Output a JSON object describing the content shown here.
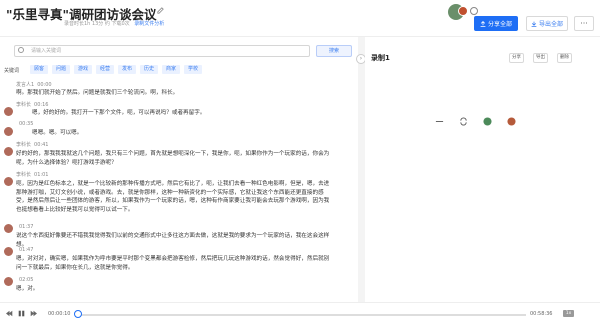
{
  "header": {
    "title": "\"乐里寻真\"调研团访谈会议",
    "meta": "录音时长1h 13分 约 下载0次",
    "meta_link": "录制文件分析"
  },
  "actions": {
    "share_label": "分享全部",
    "export_label": "导出全部",
    "more_label": "···"
  },
  "search": {
    "placeholder": "请输入关键词",
    "button_label": "搜索"
  },
  "keywords": {
    "label": "关键词",
    "items": [
      "顾客",
      "问题",
      "游戏",
      "经营",
      "发布",
      "历史",
      "商家",
      "学校"
    ]
  },
  "transcript": [
    {
      "speaker": "发言人1",
      "time": "00:00",
      "text": "啊。那我们就开始了然后。问题是就我们三个轮流问。啊，科长。"
    },
    {
      "speaker": "李科长",
      "time": "00:16",
      "text": "嗯，好的好的。我打开一下那个文件，呃，可以再说吗？或者再留字。"
    },
    {
      "speaker": "",
      "time": "00:35",
      "text": "嗯嗯。嗯。可以嗯。"
    },
    {
      "speaker": "李科长",
      "time": "00:41",
      "text": "好的好的，那我我我就这几个问题，我只有三个问题，首先就是想呃深化一下，我是你，呃，如果你作为一个玩家的话，你会为呢，为什么选择体验？呃打游戏手游呢？"
    },
    {
      "speaker": "李科长",
      "time": "01:01",
      "text": "呃，因为是红色标本之，就是一个比较新的那种传播方式吧，然后它有比了，呃，让我们去看一种红色电影啊，但是，嗯，去进那种游打咖，艾灯文创小说，或者游戏。去，就是你那样，这种一种新资化的一个实际感，它就让我这个东西能还更直接的感受，是然后然后让一些团体的游客，所以，如果我作为一个玩家的话，嗯，这种有作商家要让我可能会去玩那个游戏啊，因为我也挺想看看上比较好是我可以觉得可以试一下。"
    },
    {
      "speaker": "",
      "time": "01:37",
      "text": "说这个东西挺好像要还不错我我觉得我们以前的交通形式中让多往这方面去做，这就是我的要求为一个玩家的话，我在这会这样想。"
    },
    {
      "speaker": "",
      "time": "01:47",
      "text": "嗯，对对对，确实嗯，如果我作为呼市要是平时那个变黑都会把游客检修，然后把玩几玩这种游戏的话，然会觉得好，然后就别问一下就最后，如果你在长几，这就是你觉得。"
    },
    {
      "speaker": "",
      "time": "02:05",
      "text": "嗯，对。"
    }
  ],
  "player": {
    "current": "00:00:10",
    "total": "00:58:36",
    "progress": 0.003,
    "speed": "1x"
  },
  "right_panel": {
    "title": "录制1",
    "tools": [
      "分享",
      "导出",
      "删除"
    ]
  },
  "colors": {
    "accent": "#1e6ef5",
    "keyword_bg": "#eaf1ff",
    "keyword_text": "#3a7df0"
  }
}
